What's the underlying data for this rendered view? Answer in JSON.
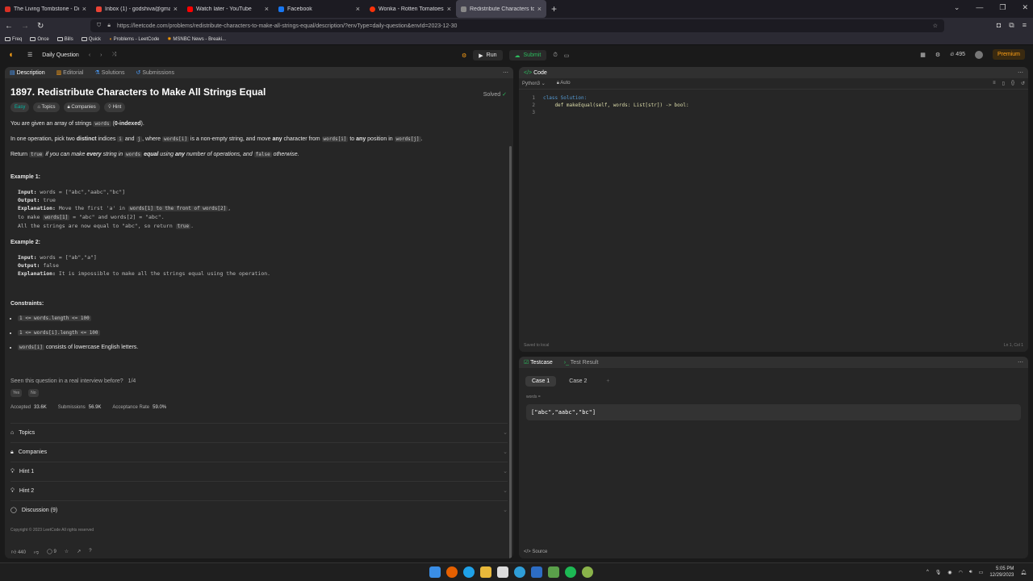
{
  "browser": {
    "tabs": [
      {
        "title": "The Living Tombstone - Dog of",
        "color": "#d93025"
      },
      {
        "title": "Inbox (1) - godshiva@gmail.co",
        "color": "#ea4335"
      },
      {
        "title": "Watch later - YouTube",
        "color": "#ff0000"
      },
      {
        "title": "Facebook",
        "color": "#1877f2"
      },
      {
        "title": "Wonka - Rotten Tomatoes",
        "color": "#fa320a"
      },
      {
        "title": "Redistribute Characters to Make",
        "color": "#888888"
      }
    ],
    "url": "https://leetcode.com/problems/redistribute-characters-to-make-all-strings-equal/description/?envType=daily-question&envId=2023-12-30",
    "bookmarks": [
      "Freq",
      "Once",
      "Bills",
      "Quick",
      "Problems - LeetCode",
      "MSNBC News - Breaki..."
    ]
  },
  "header": {
    "daily_question": "Daily Question",
    "run": "Run",
    "submit": "Submit",
    "streak": "495",
    "premium": "Premium"
  },
  "left": {
    "tabs": [
      "Description",
      "Editorial",
      "Solutions",
      "Submissions"
    ],
    "title": "1897. Redistribute Characters to Make All Strings Equal",
    "solved": "Solved",
    "chips": [
      "Easy",
      "Topics",
      "Companies",
      "Hint"
    ],
    "p1": {
      "a": "You are given an array of strings ",
      "code": "words",
      "b": " (",
      "bold": "0-indexed",
      "c": ")."
    },
    "p2": {
      "t1": "In one operation, pick two ",
      "b1": "distinct",
      "t2": " indices ",
      "c1": "i",
      "t3": " and ",
      "c2": "j",
      "t4": ", where ",
      "c3": "words[i]",
      "t5": " is a non-empty string, and move ",
      "b2": "any",
      "t6": " character from ",
      "c4": "words[i]",
      "t7": " to ",
      "b3": "any",
      "t8": " position in ",
      "c5": "words[j]",
      "t9": "."
    },
    "p3": {
      "t1": "Return ",
      "c1": "true",
      "t2": " if you can make ",
      "b1": "every",
      "t3": " string in ",
      "c2": "words",
      "t4": " ",
      "b2": "equal",
      "t5": " using ",
      "b3": "any",
      "t6": " number of operations, and ",
      "c3": "false",
      "t7": " otherwise."
    },
    "ex1_title": "Example 1:",
    "ex1": {
      "input_lbl": "Input:",
      "input": " words = [\"abc\",\"aabc\",\"bc\"]",
      "output_lbl": "Output:",
      "output": " true",
      "expl_lbl": "Explanation:",
      "expl1": " Move the first 'a' in ",
      "expl1c": "words[1] to the front of words[2]",
      "expl1e": ",",
      "expl2a": "to make ",
      "expl2c": "words[1]",
      "expl2b": " = \"abc\" and words[2] = \"abc\".",
      "expl3": "All the strings are now equal to \"abc\", so return ",
      "expl3c": "true",
      "expl3e": "."
    },
    "ex2_title": "Example 2:",
    "ex2": {
      "input_lbl": "Input:",
      "input": " words = [\"ab\",\"a\"]",
      "output_lbl": "Output:",
      "output": " false",
      "expl_lbl": "Explanation:",
      "expl": " It is impossible to make all the strings equal using the operation."
    },
    "constraints_title": "Constraints:",
    "constraints": [
      {
        "code": "1 <= words.length <= 100",
        "text": ""
      },
      {
        "code": "1 <= words[i].length <= 100",
        "text": ""
      },
      {
        "code": "words[i]",
        "text": " consists of lowercase English letters."
      }
    ],
    "seen": "Seen this question in a real interview before?",
    "seen_count": "1/4",
    "yes": "Yes",
    "no": "No",
    "stats": {
      "accepted_lbl": "Accepted",
      "accepted": "33.6K",
      "submissions_lbl": "Submissions",
      "submissions": "56.9K",
      "rate_lbl": "Acceptance Rate",
      "rate": "59.0%"
    },
    "accordions": [
      "Topics",
      "Companies",
      "Hint 1",
      "Hint 2",
      "Discussion (9)"
    ],
    "copyright": "Copyright © 2023 LeetCode All rights reserved",
    "likes": "440",
    "comments": "9"
  },
  "code": {
    "tab": "Code",
    "lang": "Python3",
    "auto": "Auto",
    "lines": [
      "class Solution:",
      "    def makeEqual(self, words: List[str]) -> bool:",
      ""
    ],
    "saved": "Saved to local",
    "cursor": "Ln 1, Col 1"
  },
  "test": {
    "tabs": [
      "Testcase",
      "Test Result"
    ],
    "cases": [
      "Case 1",
      "Case 2"
    ],
    "var": "words =",
    "value": "[\"abc\",\"aabc\",\"bc\"]",
    "source": "Source"
  },
  "taskbar": {
    "time": "5:05 PM",
    "date": "12/29/2023"
  }
}
